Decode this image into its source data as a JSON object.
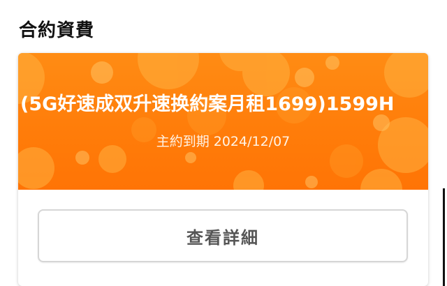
{
  "section": {
    "title": "合約資費"
  },
  "plan": {
    "name": "(5G好速成双升速换約案月租1699)1599H",
    "expiry_label": "主約到期 2024/12/07",
    "banner_color": "#ff7d0a"
  },
  "actions": {
    "details_label": "查看詳細"
  }
}
